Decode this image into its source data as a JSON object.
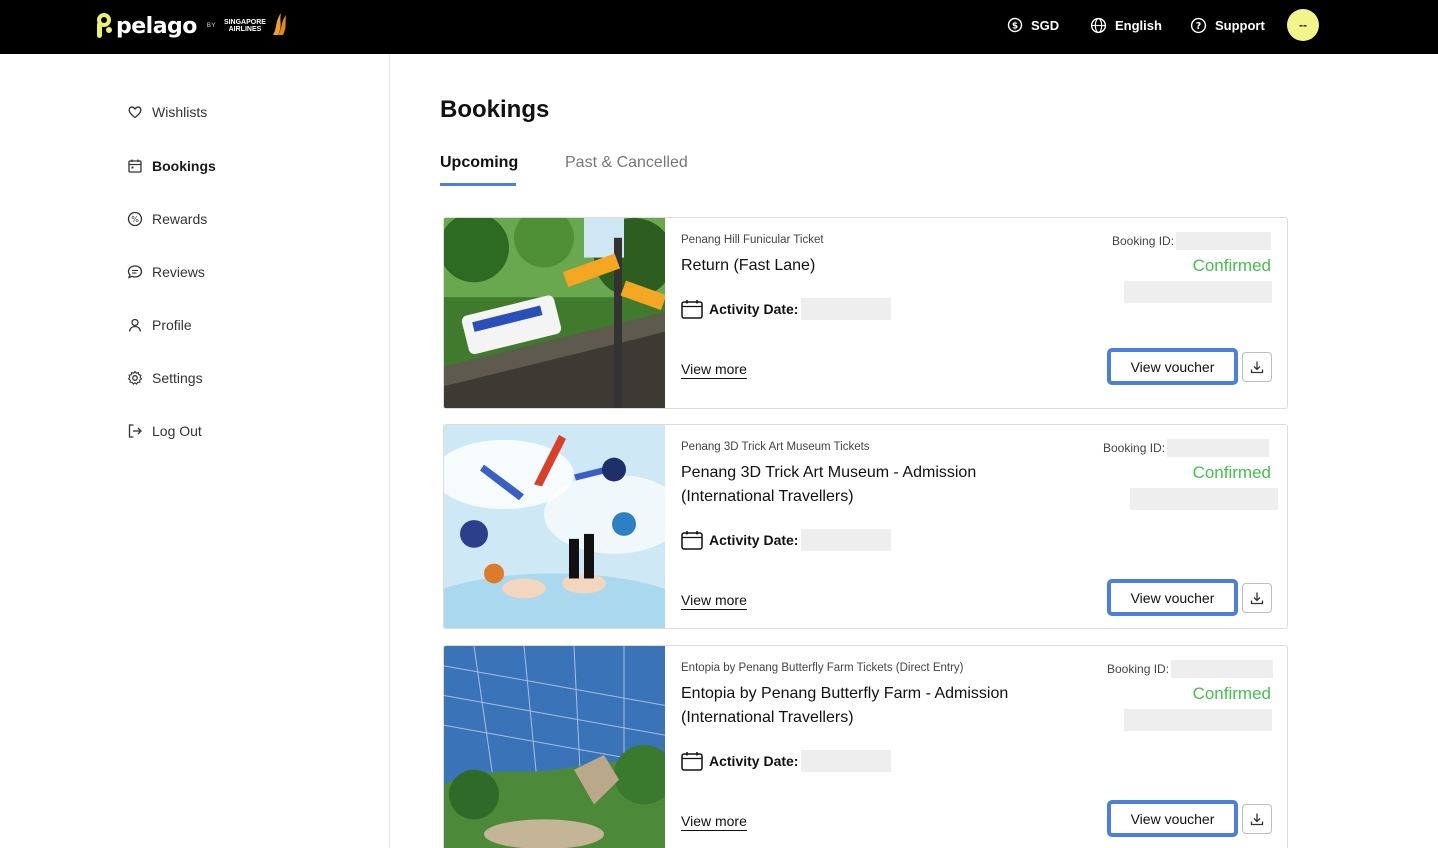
{
  "header": {
    "brand": "pelago",
    "by": "BY",
    "partner_line1": "SINGAPORE",
    "partner_line2": "AIRLINES",
    "currency": "SGD",
    "language": "English",
    "support": "Support",
    "avatar": "--"
  },
  "sidebar": {
    "items": [
      {
        "label": "Wishlists",
        "icon": "heart-icon"
      },
      {
        "label": "Bookings",
        "icon": "calendar-icon"
      },
      {
        "label": "Rewards",
        "icon": "rewards-icon"
      },
      {
        "label": "Reviews",
        "icon": "chat-icon"
      },
      {
        "label": "Profile",
        "icon": "person-icon"
      },
      {
        "label": "Settings",
        "icon": "gear-icon"
      },
      {
        "label": "Log Out",
        "icon": "logout-icon"
      }
    ]
  },
  "main": {
    "title": "Bookings",
    "tabs": [
      {
        "label": "Upcoming",
        "active": true
      },
      {
        "label": "Past & Cancelled",
        "active": false
      }
    ]
  },
  "bookings": [
    {
      "product": "Penang Hill Funicular Ticket",
      "option": "Return (Fast Lane)",
      "activity_date_label": "Activity Date:",
      "view_more": "View more",
      "booking_id_label": "Booking ID:",
      "status": "Confirmed",
      "voucher_label": "View voucher"
    },
    {
      "product": "Penang 3D Trick Art Museum Tickets",
      "option": "Penang 3D Trick Art Museum - Admission (International Travellers)",
      "activity_date_label": "Activity Date:",
      "view_more": "View more",
      "booking_id_label": "Booking ID:",
      "status": "Confirmed",
      "voucher_label": "View voucher"
    },
    {
      "product": "Entopia by Penang Butterfly Farm Tickets (Direct Entry)",
      "option": "Entopia by Penang Butterfly Farm - Admission (International Travellers)",
      "activity_date_label": "Activity Date:",
      "view_more": "View more",
      "booking_id_label": "Booking ID:",
      "status": "Confirmed",
      "voucher_label": "View voucher"
    }
  ],
  "colors": {
    "header_bg": "#000000",
    "accent": "#4a7fe0",
    "status_green": "#41c24b",
    "avatar_bg": "#f2f58a",
    "brand_yellow": "#e9f26b"
  }
}
